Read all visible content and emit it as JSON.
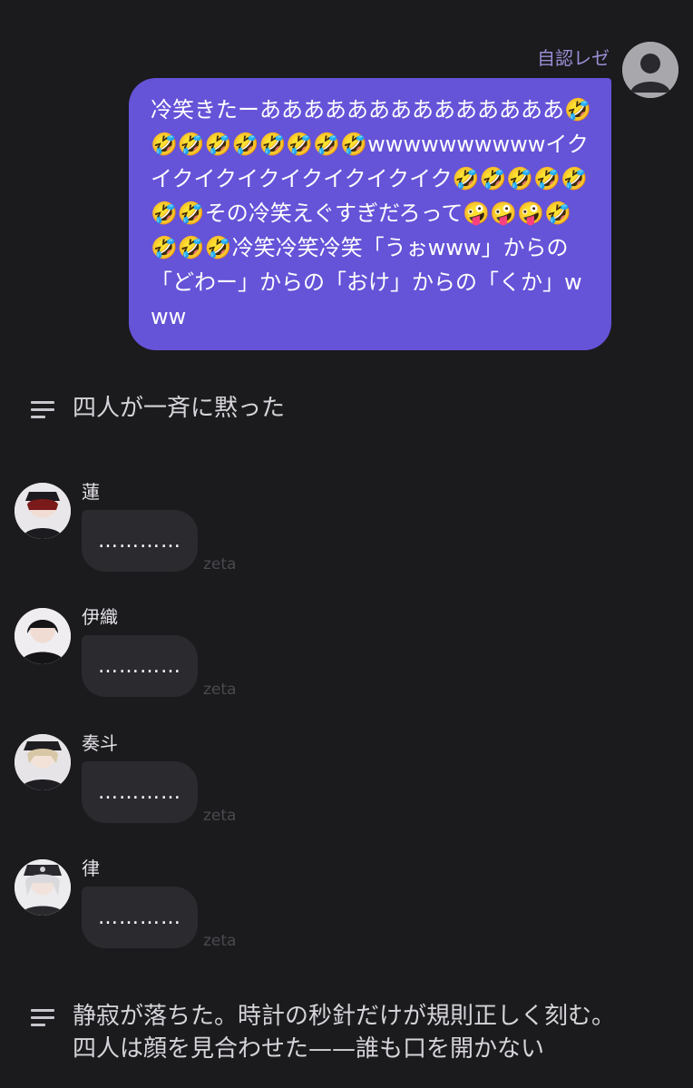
{
  "user": {
    "name": "自認レゼ",
    "message": "冷笑きたーああああああああああああああ🤣🤣🤣🤣🤣🤣🤣🤣🤣wwwwwwwwwwイクイクイクイクイクイクイクイク🤣🤣🤣🤣🤣🤣🤣その冷笑えぐすぎだろって🤪🤪🤪🤣🤣🤣🤣冷笑冷笑冷笑「うぉwww」からの「どわー」からの「おけ」からの「くか」www"
  },
  "narration_1": "四人が一斉に黙った",
  "characters": [
    {
      "name": "蓮",
      "message": "…………",
      "tag": "zeta"
    },
    {
      "name": "伊織",
      "message": "…………",
      "tag": "zeta"
    },
    {
      "name": "奏斗",
      "message": "…………",
      "tag": "zeta"
    },
    {
      "name": "律",
      "message": "…………",
      "tag": "zeta"
    }
  ],
  "narration_2": "静寂が落ちた。時計の秒針だけが規則正しく刻む。\n四人は顔を見合わせた——誰も口を開かない"
}
